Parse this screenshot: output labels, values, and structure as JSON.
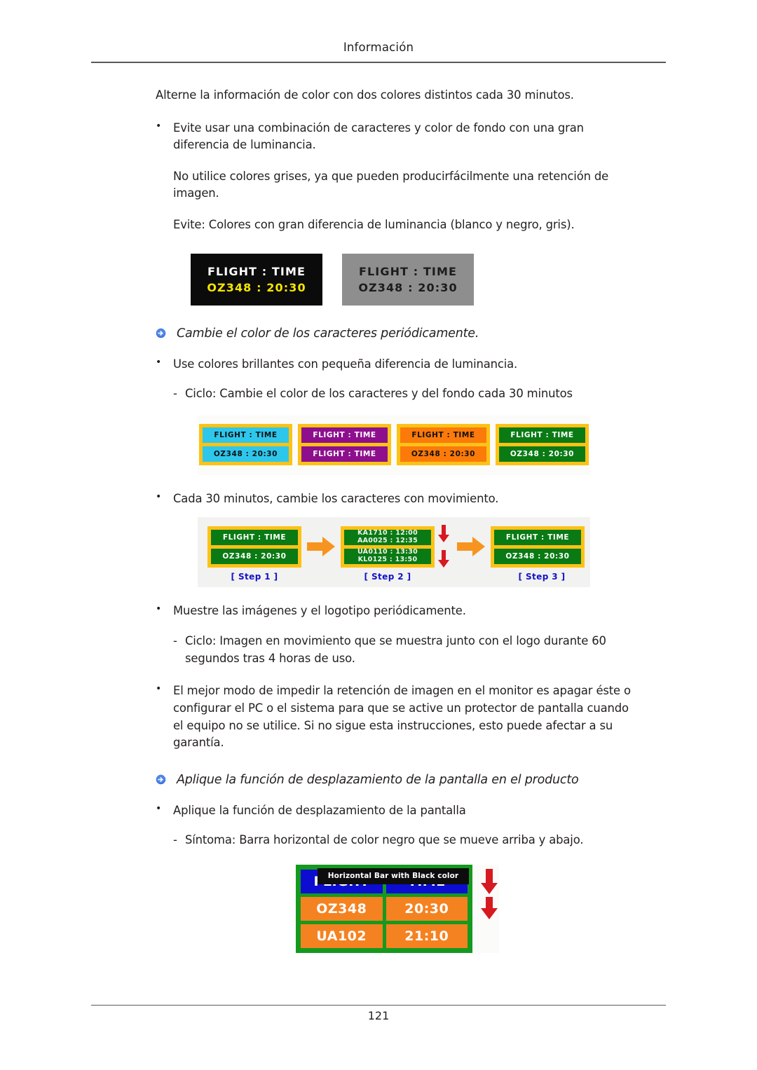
{
  "header": {
    "title": "Información"
  },
  "footer": {
    "page_number": "121"
  },
  "content": {
    "lead": "Alterne la información de color con dos colores distintos cada 30 minutos.",
    "bullet_1": "Evite usar una combinación de caracteres y color de fondo con una gran diferencia de luminancia.",
    "sub_1": "No utilice colores grises, ya que pueden producirfácilmente una retención de imagen.",
    "sub_2": "Evite: Colores con gran diferencia de luminancia (blanco y negro, gris).",
    "heading_1": "Cambie el color de los caracteres periódicamente.",
    "bullet_2": "Use colores brillantes con pequeña diferencia de luminancia.",
    "dash_1": "Ciclo: Cambie el color de los caracteres y del fondo cada 30 minutos",
    "bullet_3": "Cada 30 minutos, cambie los caracteres con movimiento.",
    "bullet_4": "Muestre las imágenes y el logotipo periódicamente.",
    "dash_2": "Ciclo: Imagen en movimiento que se muestra junto con el logo durante 60 segundos tras 4 horas de uso.",
    "bullet_5": "El mejor modo de impedir la retención de imagen en el monitor es apagar éste o configurar el PC o el sistema para que se active un protector de pantalla cuando el equipo no se utilice. Si no sigue esta instrucciones, esto puede afectar a su garantía.",
    "heading_2": "Aplique la función de desplazamiento de la pantalla en el producto",
    "bullet_6": "Aplique la función de desplazamiento de la pantalla",
    "dash_3": "Síntoma: Barra horizontal de color negro que se mueve arriba y abajo."
  },
  "figures": {
    "mono_boards": [
      {
        "name": "black-board",
        "bg": "#0b0b0b",
        "row1": "FLIGHT : TIME",
        "row2": "OZ348 : 20:30",
        "row1_color": "#ffffff",
        "row2_color": "#f5e400"
      },
      {
        "name": "gray-board",
        "bg": "#8e8e8e",
        "row1": "FLIGHT : TIME",
        "row2": "OZ348 : 20:30",
        "row1_color": "#1c1c1c",
        "row2_color": "#1c1c1c"
      }
    ],
    "color_boards": [
      {
        "name": "cyan-board",
        "frame": "#fcc216",
        "panel": "#2ec7ec",
        "text_color": "#111111",
        "row1": "FLIGHT : TIME",
        "row2": "OZ348   : 20:30"
      },
      {
        "name": "purple-board",
        "frame": "#fcc216",
        "panel": "#8d0f8d",
        "text_color": "#ffffff",
        "row1": "FLIGHT : TIME",
        "row2": "FLIGHT : TIME"
      },
      {
        "name": "orange-board",
        "frame": "#fcc216",
        "panel": "#fb7a0a",
        "text_color": "#111111",
        "row1": "FLIGHT : TIME",
        "row2": "OZ348   : 20:30"
      },
      {
        "name": "green-board",
        "frame": "#fcc216",
        "panel": "#0a7a14",
        "text_color": "#ffffff",
        "row1": "FLIGHT : TIME",
        "row2": "OZ348   : 20:30"
      }
    ],
    "steps": {
      "step1": {
        "label": "[ Step 1 ]",
        "row1": "FLIGHT : TIME",
        "row2": "OZ348   : 20:30"
      },
      "step2": {
        "label": "[ Step 2 ]",
        "row1_a": "KA1710 : 12:00",
        "row1_b": "AA0025 : 12:35",
        "row2_a": "UA0110 : 13:30",
        "row2_b": "KL0125 : 13:50"
      },
      "step3": {
        "label": "[ Step 3 ]",
        "row1": "FLIGHT : TIME",
        "row2": "OZ348   : 20:30"
      }
    },
    "bottom_board": {
      "bar_label": "Horizontal Bar with Black color",
      "header_left": "FLIGHT",
      "header_right": "TIME",
      "row1_left": "OZ348",
      "row1_right": "20:30",
      "row2_left": "UA102",
      "row2_right": "21:10",
      "frame_color": "#15991f",
      "header_color": "#0d0dd2",
      "cell_color": "#f58220",
      "bar_color": "#0d0d0d",
      "arrow_color": "#d71920"
    }
  }
}
